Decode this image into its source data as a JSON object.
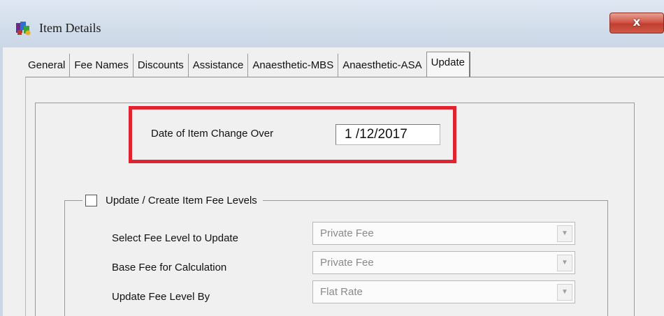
{
  "window": {
    "title": "Item Details",
    "close_label": "x"
  },
  "tabs": [
    {
      "label": "General"
    },
    {
      "label": "Fee Names"
    },
    {
      "label": "Discounts"
    },
    {
      "label": "Assistance"
    },
    {
      "label": "Anaesthetic-MBS"
    },
    {
      "label": "Anaesthetic-ASA"
    },
    {
      "label": "Update",
      "active": true
    }
  ],
  "update": {
    "date_label": "Date of Item Change Over",
    "date_value": "1 /12/2017",
    "group_label": "Update / Create Item Fee Levels",
    "group_checked": false,
    "fields": [
      {
        "label": "Select Fee Level to Update",
        "value": "Private Fee"
      },
      {
        "label": "Base Fee for Calculation",
        "value": "Private Fee"
      },
      {
        "label": "Update Fee Level By",
        "value": "Flat Rate"
      }
    ]
  },
  "colors": {
    "highlight": "#e0232e",
    "close_button": "#c94a3c",
    "titlebar": "#d3deeb"
  }
}
